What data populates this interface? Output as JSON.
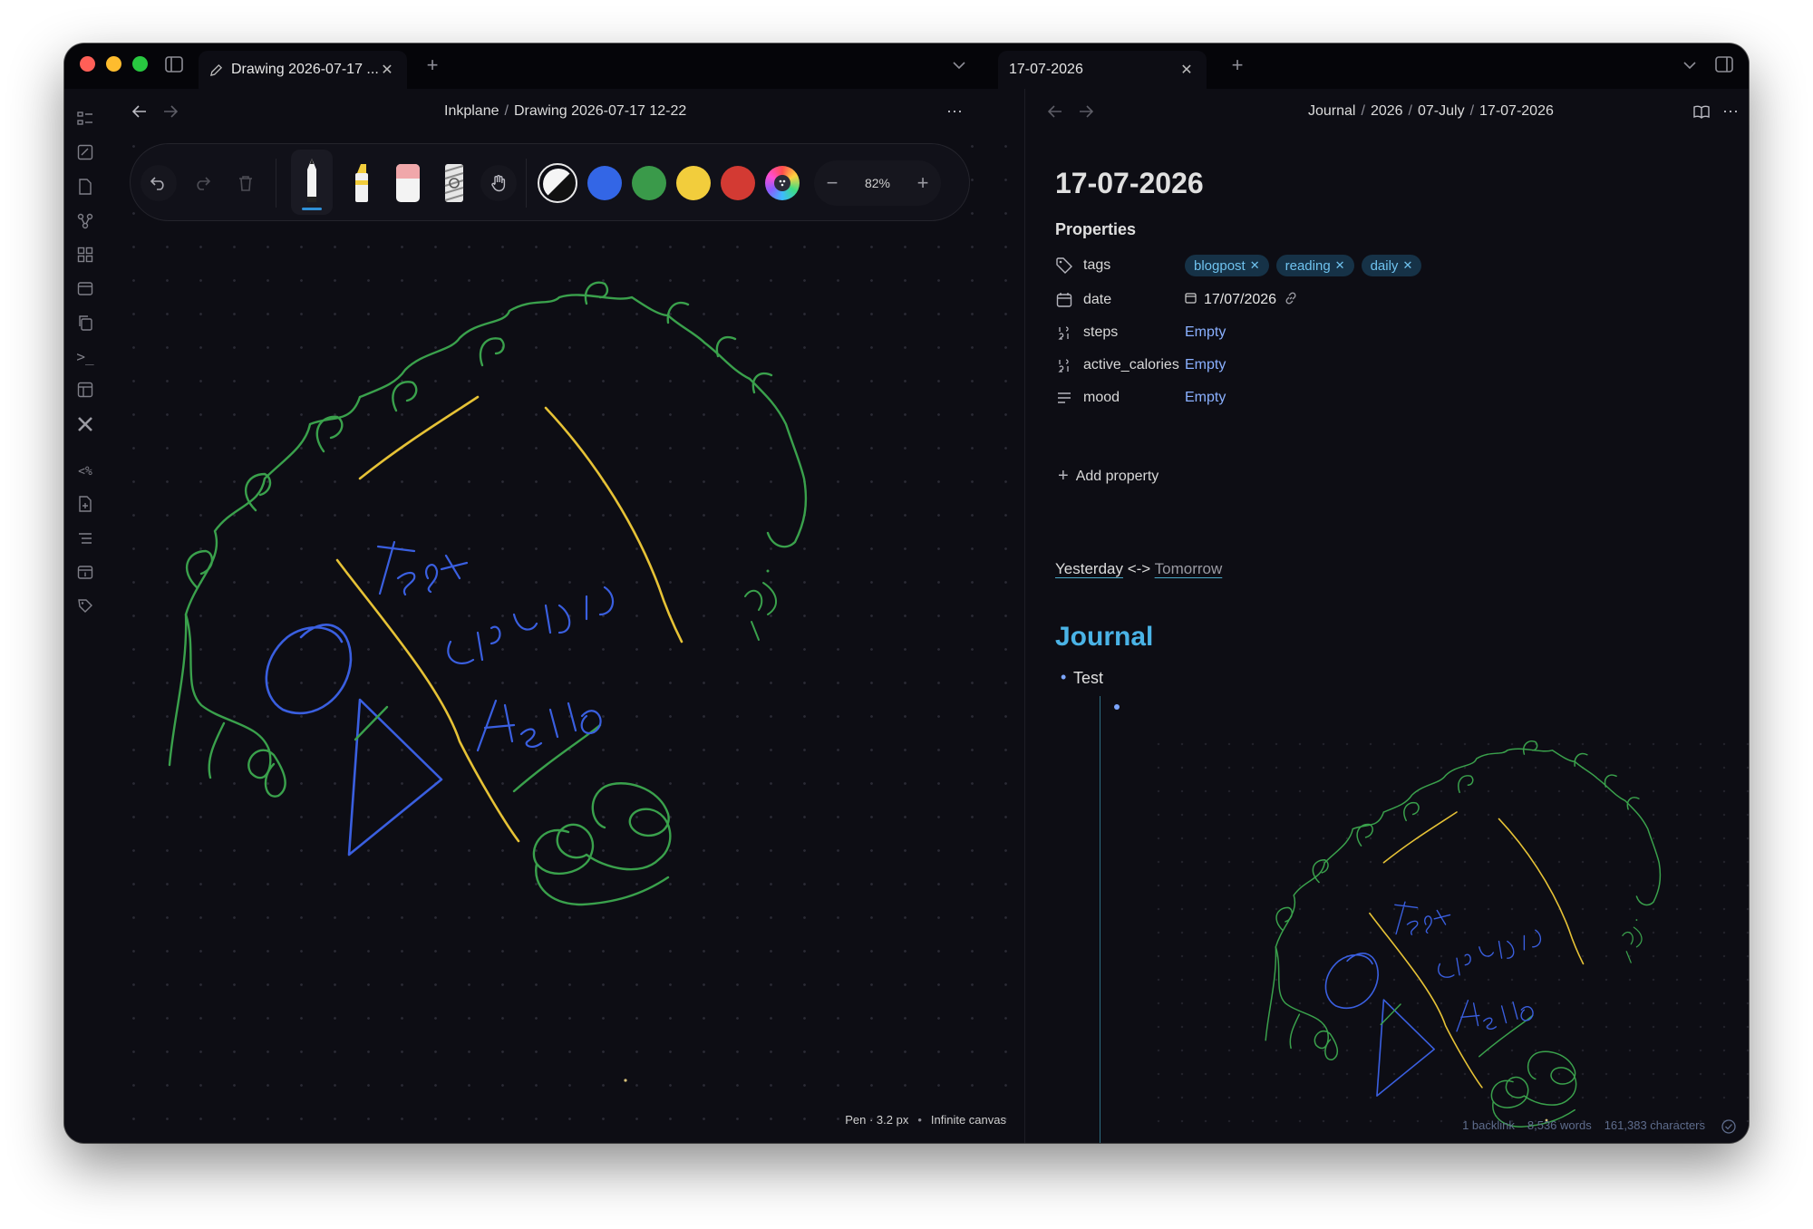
{
  "window": {
    "left_tab": {
      "title": "Drawing 2026-07-17 ..."
    },
    "right_tab": {
      "title": "17-07-2026"
    }
  },
  "left_pane": {
    "breadcrumb": [
      "Inkplane",
      "Drawing 2026-07-17 12-22"
    ],
    "toolbar": {
      "tools": [
        "pen",
        "highlighter",
        "eraser",
        "lasso",
        "hand"
      ],
      "active_tool": "pen",
      "colors": [
        "#ffffff",
        "#3366e6",
        "#3a9a4a",
        "#f2cd3c",
        "#d33a33"
      ],
      "zoom": "82%"
    },
    "status": {
      "tool": "Pen · 3.2 px",
      "mode": "Infinite canvas"
    },
    "handwriting": {
      "line1": "Test",
      "line2": "این یک متن!",
      "line3": "Hello"
    }
  },
  "right_pane": {
    "breadcrumb": [
      "Journal",
      "2026",
      "07-July",
      "17-07-2026"
    ],
    "title": "17-07-2026",
    "properties_heading": "Properties",
    "properties": [
      {
        "key": "tags",
        "icon": "tag-icon"
      },
      {
        "key": "date",
        "icon": "calendar-icon",
        "value": "17/07/2026"
      },
      {
        "key": "steps",
        "icon": "number-icon",
        "value": "Empty"
      },
      {
        "key": "active_calories",
        "icon": "number-icon",
        "value": "Empty"
      },
      {
        "key": "mood",
        "icon": "text-lines-icon",
        "value": "Empty"
      }
    ],
    "tags": [
      "blogpost",
      "reading",
      "daily"
    ],
    "add_property": "Add property",
    "nav": {
      "prev": "Yesterday",
      "sep": " <-> ",
      "next": "Tomorrow"
    },
    "journal_heading": "Journal",
    "bullet": "Test",
    "status": {
      "backlinks": "1 backlink",
      "words": "8,536 words",
      "chars": "161,383 characters"
    }
  }
}
